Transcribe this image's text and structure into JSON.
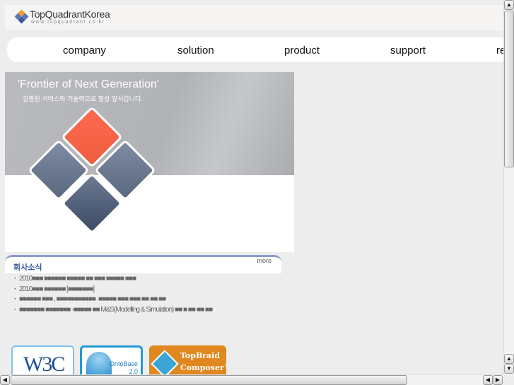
{
  "header": {
    "logo_name": "TopQuadrantKorea",
    "logo_url": "www.topquadrant.co.kr"
  },
  "nav": {
    "items": [
      "company",
      "solution",
      "product",
      "support",
      "re"
    ]
  },
  "banner": {
    "title": "'Frontier of Next Generation'",
    "subtitle": "검증된 서비스와 기술력으로 항상 앞서갑니다."
  },
  "news": {
    "title": "회사소식",
    "more": "more",
    "items": [
      "2010■■■ ■■■■■■ ■■■■■ ■■ ■■■ ■■■■■ ■■■",
      "2010■■■ ■■■■■■ [■■■■■■■]",
      "■■■■■■ ■■■ , ■■■■■■■■■■■ ·■■■■■ ■■■ ■■■ ■■·■■ ■■",
      "■■■■■■■ ■■■■■■■ ·■■■■■ ■■ M&S(Modelling & Simulation) ■■ ■ ■■·■■ ■■"
    ]
  },
  "badges": {
    "w3c": "W3C",
    "ontobase": "OntoBase 2.0",
    "topbraid": "TopBraid Composer™"
  },
  "colors": {
    "accent": "#3b5aa0",
    "topbraid": "#e0871f",
    "ontobase": "#1e9ad6"
  }
}
